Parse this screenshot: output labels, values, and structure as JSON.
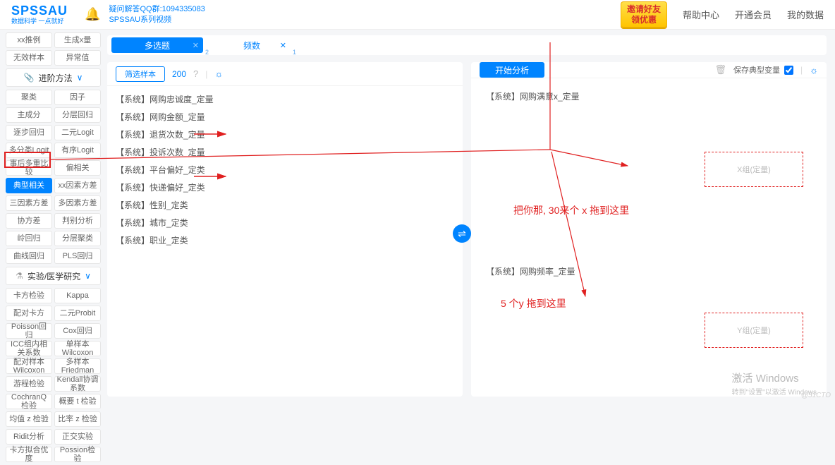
{
  "header": {
    "logo": "SPSSAU",
    "logo_sub": "数据科学 一点就好",
    "qq_line1": "疑问解答QQ群:1094335083",
    "qq_line2": "SPSSAU系列视频",
    "invite_line1": "邀请好友",
    "invite_line2": "领优惠",
    "help": "帮助中心",
    "vip": "开通会员",
    "mydata": "我的数据"
  },
  "sidebar": {
    "row0": [
      "xx推例",
      "生成x量"
    ],
    "row1": [
      "无效样本",
      "异常值"
    ],
    "section1_title": "进阶方法",
    "s1": [
      [
        "聚类",
        "因子"
      ],
      [
        "主成分",
        "分层回归"
      ],
      [
        "逐步回归",
        "二元Logit"
      ],
      [
        "多分类Logit",
        "有序Logit"
      ],
      [
        "事后多重比较",
        "偏相关"
      ],
      [
        "典型相关",
        "xx因素方差"
      ],
      [
        "三因素方差",
        "多因素方差"
      ],
      [
        "协方差",
        "判别分析"
      ],
      [
        "岭回归",
        "分层聚类"
      ],
      [
        "曲线回归",
        "PLS回归"
      ]
    ],
    "section2_title": "实验/医学研究",
    "s2": [
      [
        "卡方检验",
        "Kappa"
      ],
      [
        "配对卡方",
        "二元Probit"
      ],
      [
        "Poisson回归",
        "Cox回归"
      ],
      [
        "ICC组内相关系数",
        "单样本Wilcoxon"
      ],
      [
        "配对样本Wilcoxon",
        "多样本Friedman"
      ],
      [
        "游程检验",
        "Kendall协调系数"
      ],
      [
        "CochranQ检验",
        "概要 t 检验"
      ],
      [
        "均值 z 检验",
        "比率 z 检验"
      ],
      [
        "Ridit分析",
        "正交实验"
      ],
      [
        "卡方拟合优度",
        "Possion检验"
      ]
    ]
  },
  "tags": {
    "tag1": "多选题",
    "tag1_sub": "2",
    "tag2": "频数",
    "tag2_sub": "1"
  },
  "left_panel": {
    "filter": "筛选样本",
    "count": "200",
    "vars": [
      "【系统】网购忠诚度_定量",
      "【系统】网购金额_定量",
      "【系统】退货次数_定量",
      "【系统】投诉次数_定量",
      "【系统】平台偏好_定类",
      "【系统】快递偏好_定类",
      "【系统】性别_定类",
      "【系统】城市_定类",
      "【系统】职业_定类"
    ]
  },
  "right_panel": {
    "start": "开始分析",
    "save_model": "保存典型变量",
    "zone1_item": "【系统】网购满意x_定量",
    "zone1_box": "X组(定量)",
    "zone2_item": "【系统】网购频率_定量",
    "zone2_box": "Y组(定量)"
  },
  "annotations": {
    "a1": "把你那, 30来个 x 拖到这里",
    "a2": "5 个y 拖到这里"
  },
  "watermark": {
    "l1": "激活 Windows",
    "l2": "转到\"设置\"以激活 Windows",
    "wm2": "@51CTO"
  }
}
